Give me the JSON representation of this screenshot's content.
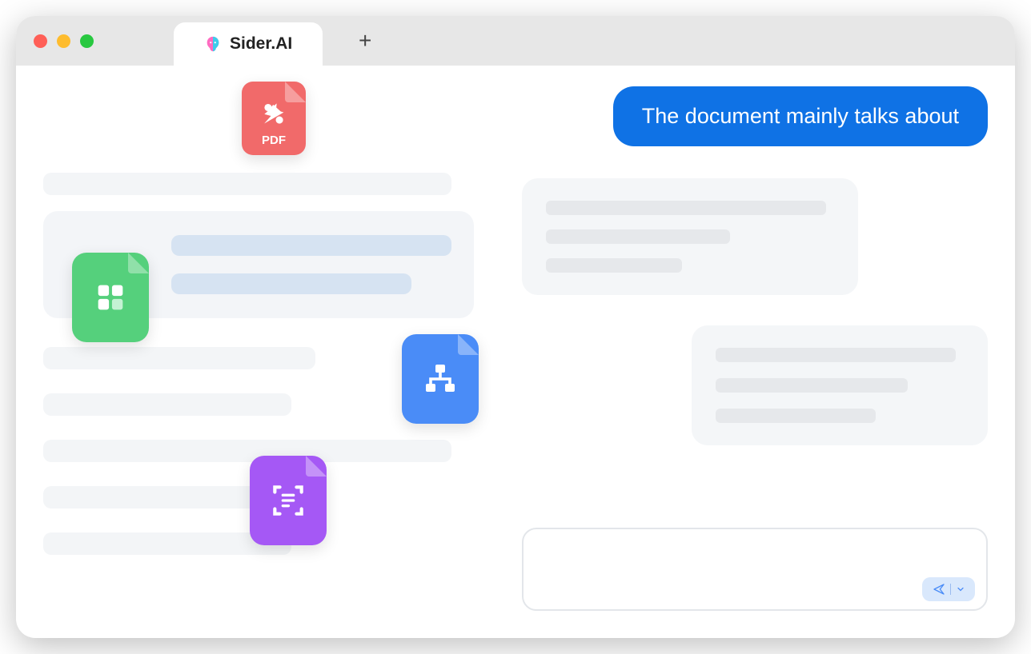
{
  "window": {
    "tab_title": "Sider.AI"
  },
  "files": {
    "pdf_label": "PDF"
  },
  "chat": {
    "user_message": "The document mainly talks about"
  },
  "icons": {
    "pdf": "pdf-file-icon",
    "grid": "grid-file-icon",
    "org": "org-chart-file-icon",
    "scan": "scan-file-icon",
    "send": "send-icon",
    "dropdown": "chevron-down-icon",
    "plus": "plus-icon"
  },
  "colors": {
    "accent": "#0f72e5",
    "pdf": "#f16a6a",
    "grid": "#55d07c",
    "org": "#4a8cf7",
    "scan": "#a558f5"
  }
}
